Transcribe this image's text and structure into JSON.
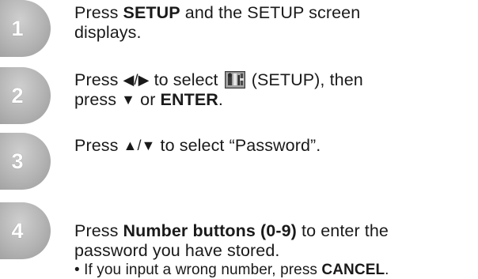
{
  "steps": [
    {
      "number": "1",
      "line1_pre": "Press ",
      "line1_bold": "SETUP",
      "line1_post": " and the SETUP screen",
      "line2": "displays."
    },
    {
      "number": "2",
      "line1_pre": "Press ",
      "arrows": "◀/▶",
      "line1_mid": " to select ",
      "line1_post": " (SETUP), then",
      "line2_pre": "press ",
      "down": "▼",
      "line2_mid": " or ",
      "line2_bold": "ENTER",
      "line2_post": ".",
      "icon": "setup-icon"
    },
    {
      "number": "3",
      "line1_pre": "Press ",
      "arrows": "▲/▼",
      "line1_post": " to select “Password”."
    },
    {
      "number": "4",
      "line1_pre": "Press ",
      "line1_bold": "Number buttons (0-9)",
      "line1_post": " to enter the",
      "line2": "password you have stored.",
      "note_pre": "• If you input a wrong number, press ",
      "note_bold": "CANCEL",
      "note_post": "."
    }
  ]
}
